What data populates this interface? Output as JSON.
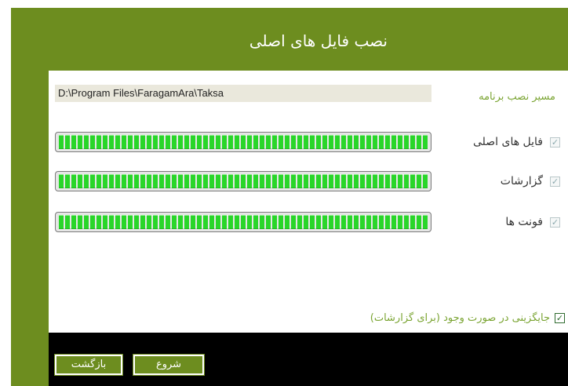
{
  "header": {
    "title": "نصب فایل های اصلی"
  },
  "install_path": {
    "label": "مسیر نصب برنامه",
    "value": "D:\\Program Files\\FaragamAra\\Taksa"
  },
  "components": [
    {
      "label": "فایل های اصلی",
      "checked": true,
      "progress": 1.0
    },
    {
      "label": "گزارشات",
      "checked": true,
      "progress": 1.0
    },
    {
      "label": "فونت ها",
      "checked": true,
      "progress": 1.0
    }
  ],
  "replace_option": {
    "label": "جایگزینی در صورت وجود  (برای گزارشات)",
    "checked": true
  },
  "buttons": {
    "back": "بازگشت",
    "start": "شروع"
  },
  "colors": {
    "accent": "#6d8d1f",
    "progress": "#29d629",
    "label_green": "#7aa432"
  },
  "icons": {
    "checkbox": "check-mark"
  }
}
